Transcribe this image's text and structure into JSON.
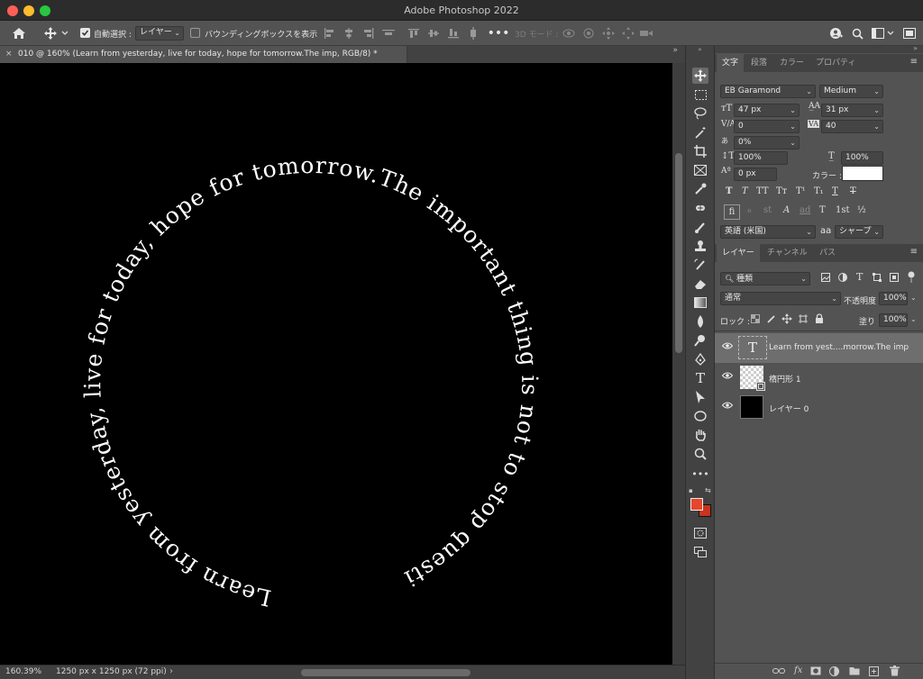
{
  "window": {
    "title": "Adobe Photoshop 2022",
    "colors": {
      "close": "#fe5f57",
      "minimize": "#febc2e",
      "zoom": "#28c840"
    }
  },
  "options_bar": {
    "auto_select_label": "自動選択 :",
    "auto_select_checked": true,
    "auto_select_target": "レイヤー",
    "bounding_box_label": "バウンディングボックスを表示",
    "bounding_box_checked": false,
    "mode_3d_label": "3D モード :"
  },
  "document": {
    "tab_title": "010 @ 160% (Learn from yesterday, live for today, hope for tomorrow.The imp, RGB/8) *",
    "canvas_text": "Learn from yesterday, live for today, hope for tomorrow.The important thing is not to stop questioning.~Albert",
    "zoom": "160.39%",
    "doc_size": "1250 px x 1250 px (72 ppi)"
  },
  "tools": [
    "move-tool",
    "marquee-tool",
    "lasso-tool",
    "magic-wand-tool",
    "crop-tool",
    "frame-tool",
    "eyedropper-tool",
    "healing-brush-tool",
    "brush-tool",
    "clone-stamp-tool",
    "history-brush-tool",
    "eraser-tool",
    "gradient-tool",
    "blur-tool",
    "dodge-tool",
    "pen-tool",
    "type-tool",
    "path-selection-tool",
    "ellipse-tool",
    "hand-tool",
    "zoom-tool",
    "more-tools"
  ],
  "colors": {
    "foreground": "#e8452c",
    "background": "#e8452c"
  },
  "character_panel": {
    "tabs": [
      "文字",
      "段落",
      "カラー",
      "プロパティ"
    ],
    "active_tab": 0,
    "font_family": "EB Garamond",
    "font_style": "Medium",
    "font_size": "47 px",
    "leading": "31 px",
    "kerning": "0",
    "tracking": "40",
    "tsume": "0%",
    "vertical_scale": "100%",
    "horizontal_scale": "100%",
    "baseline_shift": "0 px",
    "color_label": "カラー :",
    "text_color": "#ffffff",
    "language": "英語 (米国)",
    "aa_label": "aa",
    "antialias": "シャープ",
    "style_buttons": [
      "T",
      "T",
      "TT",
      "Tт",
      "T¹",
      "T₁",
      "T",
      "T"
    ],
    "opentype_buttons": [
      "fi",
      "ℴ",
      "st",
      "A",
      "ad",
      "T",
      "1st",
      "½"
    ]
  },
  "layers_panel": {
    "tabs": [
      "レイヤー",
      "チャンネル",
      "パス"
    ],
    "active_tab": 0,
    "filter_kind": "種類",
    "blend_mode": "通常",
    "opacity_label": "不透明度 :",
    "opacity": "100%",
    "lock_label": "ロック :",
    "fill_label": "塗り :",
    "fill": "100%",
    "layers": [
      {
        "name": "Learn from yest....morrow.The imp",
        "kind": "text",
        "selected": true
      },
      {
        "name": "楕円形 1",
        "kind": "shape",
        "selected": false
      },
      {
        "name": "レイヤー 0",
        "kind": "fill",
        "selected": false
      }
    ]
  }
}
